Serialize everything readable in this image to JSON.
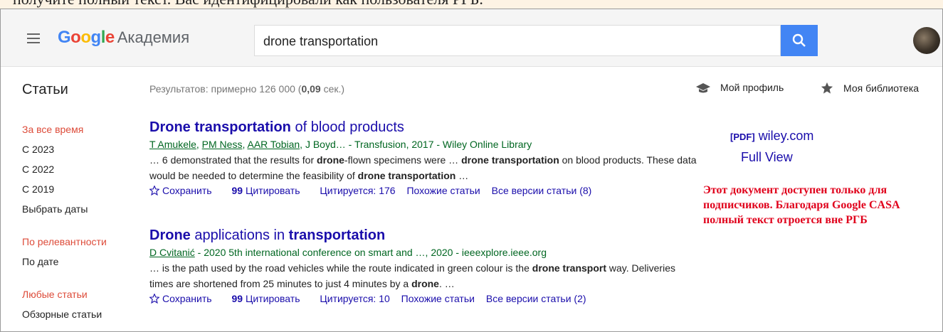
{
  "top_strip": {
    "text": "получите полный текст. Вас идентифицировали как пользователя РГБ."
  },
  "header": {
    "logo_google": "Google",
    "logo_academy": "Академия",
    "search_value": "drone transportation",
    "colors": {
      "blue": "#4285f4",
      "red": "#ea4335",
      "yellow": "#fbbc05",
      "green": "#34a853"
    }
  },
  "subheader": {
    "section_title": "Статьи",
    "results_prefix": "Результатов: примерно 126 000 (",
    "results_time": "0,09",
    "results_suffix": " сек.)",
    "my_profile": "Мой профиль",
    "my_library": "Моя библиотека"
  },
  "sidebar": {
    "time": [
      "За все время",
      "С 2023",
      "С 2022",
      "С 2019",
      "Выбрать даты"
    ],
    "sort": [
      "По релевантности",
      "По дате"
    ],
    "type": [
      "Любые статьи",
      "Обзорные статьи"
    ]
  },
  "results": [
    {
      "title_bold": "Drone transportation",
      "title_rest": " of blood products",
      "authors": [
        "T Amukele",
        "PM Ness",
        "AAR Tobian"
      ],
      "meta_rest": ", J Boyd… - Transfusion, 2017 - Wiley Online Library",
      "snippet": [
        {
          "t": "… 6 demonstrated that the results for ",
          "b": false
        },
        {
          "t": "drone",
          "b": true
        },
        {
          "t": "-flown specimens were … ",
          "b": false
        },
        {
          "t": "drone transportation",
          "b": true
        },
        {
          "t": " on blood products. These data would be needed to determine the feasibility of ",
          "b": false
        },
        {
          "t": "drone transportation",
          "b": true
        },
        {
          "t": " …",
          "b": false
        }
      ],
      "save": "Сохранить",
      "cite": "Цитировать",
      "cited_by": "Цитируется: 176",
      "related": "Похожие статьи",
      "versions": "Все версии статьи (8)"
    },
    {
      "title_bold": "Drone",
      "title_mid": " applications in ",
      "title_bold2": "transportation",
      "authors": [
        "D Cvitanić"
      ],
      "meta_rest": " - 2020 5th international conference on smart and …, 2020 - ieeexplore.ieee.org",
      "snippet": [
        {
          "t": "… is the path used by the road vehicles while the route indicated in green colour is the ",
          "b": false
        },
        {
          "t": "drone transport",
          "b": true
        },
        {
          "t": " way. Deliveries times are shortened from 25 minutes to just 4 minutes by a ",
          "b": false
        },
        {
          "t": "drone",
          "b": true
        },
        {
          "t": ". …",
          "b": false
        }
      ],
      "save": "Сохранить",
      "cite": "Цитировать",
      "cited_by": "Цитируется: 10",
      "related": "Похожие статьи",
      "versions": "Все версии статьи (2)"
    }
  ],
  "side": {
    "pdf_tag": "[PDF]",
    "pdf_source": "wiley.com",
    "full_view": "Full View",
    "annotation": "Этот документ доступен только для подписчиков. Благодаря Google CASA полный текст отроется вне РГБ"
  }
}
